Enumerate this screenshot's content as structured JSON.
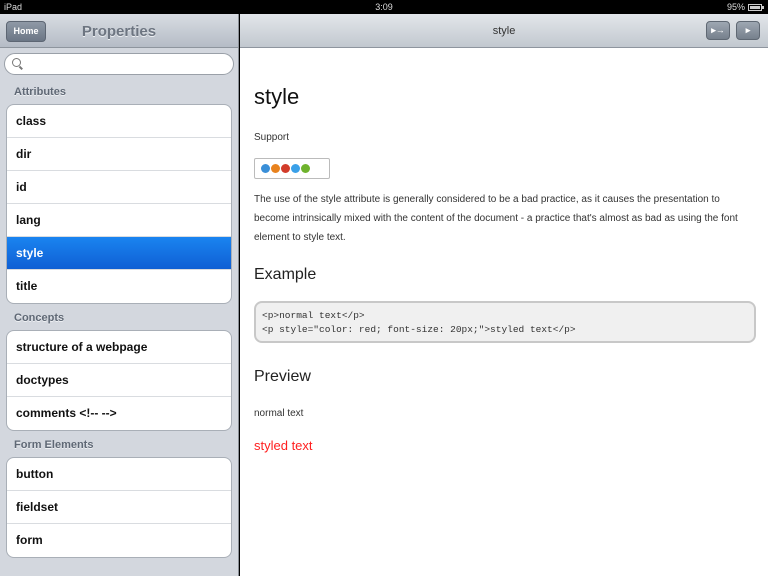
{
  "status_bar": {
    "device": "iPad",
    "time": "3:09",
    "battery": "95%"
  },
  "sidebar": {
    "home_label": "Home",
    "title": "Properties",
    "search_placeholder": "",
    "sections": [
      {
        "header": "Attributes",
        "items": [
          "class",
          "dir",
          "id",
          "lang",
          "style",
          "title"
        ]
      },
      {
        "header": "Concepts",
        "items": [
          "structure of a webpage",
          "doctypes",
          "comments <!-- -->"
        ]
      },
      {
        "header": "Form Elements",
        "items": [
          "button",
          "fieldset",
          "form"
        ]
      }
    ],
    "selected_item": "style"
  },
  "detail": {
    "nav_title": "style",
    "next_label": "▸→",
    "prev_label": "▸",
    "heading": "style",
    "support_label": "Support",
    "browser_icon_colors": [
      "#3a8fd8",
      "#e8821e",
      "#d23c2a",
      "#3aa0e8",
      "#6fb32d"
    ],
    "description": "The use of the style attribute is generally considered to be a bad practice, as it causes the presentation to become intrinsically mixed with the content of the document - a practice that's almost as bad as using the font element to style text.",
    "example_heading": "Example",
    "code_line1": "<p>normal text</p>",
    "code_line2": "<p style=\"color: red; font-size: 20px;\">styled text</p>",
    "preview_heading": "Preview",
    "preview_normal": "normal text",
    "preview_styled": "styled text",
    "styled_color": "#ff2020"
  }
}
